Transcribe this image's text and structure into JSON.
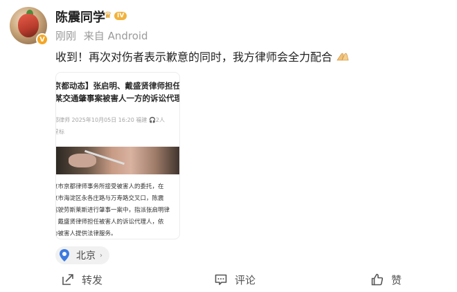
{
  "user": {
    "name": "陈震同学",
    "level": "IV",
    "verified_mark": "V"
  },
  "meta": {
    "time": "刚刚",
    "source": "来自 Android"
  },
  "post": {
    "text": "收到！再次对伤者表示歉意的同时，我方律师会全力配合",
    "emoji": "folded-hands-emoji"
  },
  "card": {
    "title_line1": "京都动态】张启明、戴盛贤律师担任",
    "title_line2": "某交通肇事案被害人一方的诉讼代理",
    "byline": "都律师   2025年10月05日 16:20  福建   🎧2人",
    "tag": "星标",
    "body_lines": [
      "京市京都律师事务所接受被害人的委托，在",
      "京市海淀区永各庄路与万寿路交叉口，陈震",
      "驾驶劳斯莱斯进行肇事一案中，指派张启明律",
      "、戴盛贤律师担任被害人的诉讼代理人，依",
      "为被害人提供法律服务。"
    ]
  },
  "location": {
    "label": "北京",
    "icon": "location-pin-icon"
  },
  "actions": {
    "share_label": "转发",
    "comment_label": "评论",
    "like_label": "赞"
  },
  "colors": {
    "accent_location": "#3d7be0",
    "badge_gold": "#f2b23c",
    "muted_text": "#9a9a9a"
  }
}
